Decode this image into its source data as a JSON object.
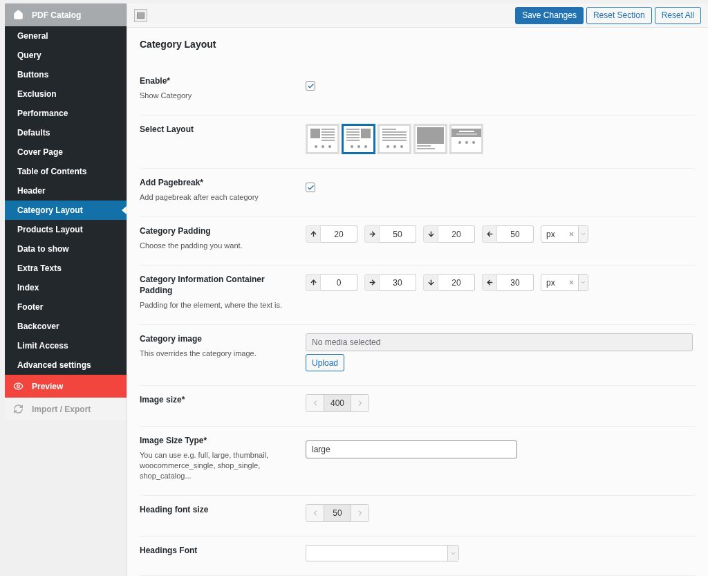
{
  "sidebar": {
    "title": "PDF Catalog",
    "items": [
      {
        "label": "General",
        "selected": false
      },
      {
        "label": "Query",
        "selected": false
      },
      {
        "label": "Buttons",
        "selected": false
      },
      {
        "label": "Exclusion",
        "selected": false
      },
      {
        "label": "Performance",
        "selected": false
      },
      {
        "label": "Defaults",
        "selected": false
      },
      {
        "label": "Cover Page",
        "selected": false
      },
      {
        "label": "Table of Contents",
        "selected": false
      },
      {
        "label": "Header",
        "selected": false
      },
      {
        "label": "Category Layout",
        "selected": true
      },
      {
        "label": "Products Layout",
        "selected": false
      },
      {
        "label": "Data to show",
        "selected": false
      },
      {
        "label": "Extra Texts",
        "selected": false
      },
      {
        "label": "Index",
        "selected": false
      },
      {
        "label": "Footer",
        "selected": false
      },
      {
        "label": "Backcover",
        "selected": false
      },
      {
        "label": "Limit Access",
        "selected": false
      },
      {
        "label": "Advanced settings",
        "selected": false
      }
    ],
    "preview": "Preview",
    "import_export": "Import / Export"
  },
  "toolbar": {
    "buttons": [
      {
        "label": "Save Changes",
        "kind": "primary"
      },
      {
        "label": "Reset Section",
        "kind": "secondary"
      },
      {
        "label": "Reset All",
        "kind": "secondary"
      }
    ]
  },
  "section_title": "Category Layout",
  "fields": [
    {
      "kind": "checkbox",
      "label": "Enable*",
      "description": "Show Category",
      "checked": true
    },
    {
      "kind": "layout_picker",
      "label": "Select Layout",
      "options": [
        {
          "kind": "image_left",
          "selected": false
        },
        {
          "kind": "image_right",
          "selected": true
        },
        {
          "kind": "text_only",
          "selected": false
        },
        {
          "kind": "image_top",
          "selected": false
        },
        {
          "kind": "banner",
          "selected": false
        }
      ]
    },
    {
      "kind": "checkbox",
      "label": "Add Pagebreak*",
      "description": "Add pagebreak after each category",
      "checked": true
    },
    {
      "kind": "spacing",
      "label": "Category Padding",
      "description": "Choose the padding you want.",
      "sides": [
        {
          "kind": "up",
          "value": "20"
        },
        {
          "kind": "right",
          "value": "50"
        },
        {
          "kind": "down",
          "value": "20"
        },
        {
          "kind": "left",
          "value": "50"
        }
      ],
      "unit": "px"
    },
    {
      "kind": "spacing",
      "label": "Category Information Container Padding",
      "description": "Padding for the element, where the text is.",
      "sides": [
        {
          "kind": "up",
          "value": "0"
        },
        {
          "kind": "right",
          "value": "30"
        },
        {
          "kind": "down",
          "value": "20"
        },
        {
          "kind": "left",
          "value": "30"
        }
      ],
      "unit": "px"
    },
    {
      "kind": "media",
      "label": "Category image",
      "description": "This overrides the category image.",
      "placeholder": "No media selected",
      "button": "Upload"
    },
    {
      "kind": "stepper",
      "label": "Image size*",
      "value": "400"
    },
    {
      "kind": "text",
      "label": "Image Size Type*",
      "description": "You can use e.g. full, large, thumbnail, woocommerce_single, shop_single, shop_catalog...",
      "value": "large"
    },
    {
      "kind": "stepper",
      "label": "Heading font size",
      "value": "50"
    },
    {
      "kind": "select",
      "label": "Headings Font"
    }
  ]
}
